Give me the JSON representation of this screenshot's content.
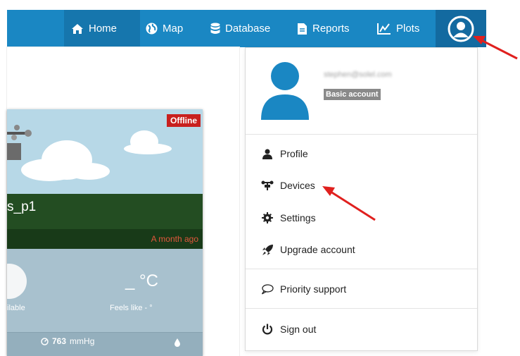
{
  "nav": {
    "items": [
      {
        "label": "Home",
        "icon": "home-icon"
      },
      {
        "label": "Map",
        "icon": "globe-icon"
      },
      {
        "label": "Database",
        "icon": "database-icon"
      },
      {
        "label": "Reports",
        "icon": "file-icon"
      },
      {
        "label": "Plots",
        "icon": "chart-icon"
      }
    ],
    "avatar_icon": "user-circle-icon"
  },
  "card": {
    "station_name": "s_p1",
    "offline_badge": "Offline",
    "time_ago": "A month ago",
    "temperature": "_ °C",
    "unavailable": "ilable",
    "feels_like": "Feels like - °",
    "pressure_value": "763",
    "pressure_unit": "mmHg"
  },
  "dropdown": {
    "user_email": "stephen@solel.com",
    "account_type": "Basic account",
    "items": [
      {
        "label": "Profile",
        "icon": "user-icon"
      },
      {
        "label": "Devices",
        "icon": "station-icon"
      },
      {
        "label": "Settings",
        "icon": "gear-icon"
      },
      {
        "label": "Upgrade account",
        "icon": "rocket-icon"
      },
      {
        "label": "Priority support",
        "icon": "speech-bubble-icon"
      },
      {
        "label": "Sign out",
        "icon": "power-icon"
      }
    ]
  },
  "colors": {
    "nav_bg": "#1a87c3",
    "accent_arrow": "#e0201e",
    "offline": "#c8201e"
  }
}
